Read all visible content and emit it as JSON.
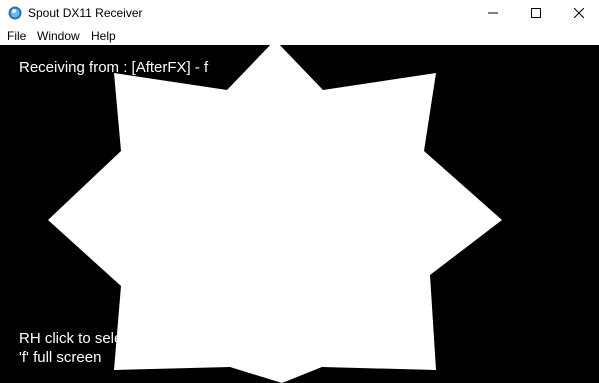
{
  "window": {
    "title": "Spout DX11 Receiver",
    "icon": "spout-app-icon"
  },
  "controls": {
    "minimize_icon": "minimize-icon",
    "maximize_icon": "maximize-icon",
    "close_icon": "close-icon"
  },
  "menu": {
    "items": [
      {
        "label": "File"
      },
      {
        "label": "Window"
      },
      {
        "label": "Help"
      }
    ]
  },
  "content": {
    "background": "#000000",
    "receiving_text": "Receiving from : [AfterFX] - f",
    "rh_text": "RH click to sele",
    "fullscreen_text": "'f' full screen",
    "shape": "eight-point-star",
    "shape_color": "#ffffff"
  }
}
